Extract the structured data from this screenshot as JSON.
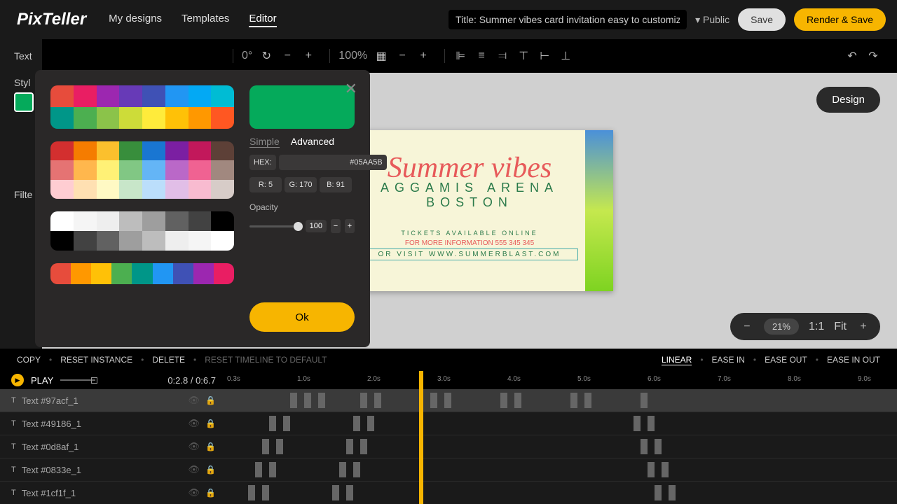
{
  "header": {
    "logo": "PixTeller",
    "nav": {
      "designs": "My designs",
      "templates": "Templates",
      "editor": "Editor"
    },
    "title_label": "Title:",
    "title_value": "Summer vibes card invitation easy to customiz",
    "visibility": "▾ Public",
    "save": "Save",
    "render": "Render & Save"
  },
  "sidebar": {
    "text": "Text",
    "style": "Styl",
    "filter": "Filte"
  },
  "toolbar": {
    "rotation": "0°",
    "zoom": "100%"
  },
  "canvas": {
    "design_chip": "Design",
    "card": {
      "title": "Summer vibes",
      "subtitle": "AGGAMIS ARENA BOSTON",
      "line1": "TICKETS AVAILABLE ONLINE",
      "line2": "FOR MORE INFORMATION 555 345 345",
      "line3": "OR VISIT WWW.SUMMERBLAST.COM"
    },
    "zoom": {
      "value": "21%",
      "ratio": "1:1",
      "fit": "Fit"
    }
  },
  "picker": {
    "tabs": {
      "simple": "Simple",
      "advanced": "Advanced"
    },
    "hex_label": "HEX:",
    "hex_value": "#05AA5B",
    "r_label": "R:",
    "r_val": "5",
    "g_label": "G:",
    "g_val": "170",
    "b_label": "B:",
    "b_val": "91",
    "opacity_label": "Opacity",
    "opacity_val": "100",
    "ok": "Ok",
    "preview_color": "#05AA5B"
  },
  "timeline": {
    "actions": {
      "copy": "COPY",
      "reset_instance": "RESET INSTANCE",
      "delete": "DELETE",
      "reset_tl": "RESET TIMELINE TO DEFAULT"
    },
    "easing": {
      "linear": "LINEAR",
      "ease_in": "EASE IN",
      "ease_out": "EASE OUT",
      "ease_in_out": "EASE IN OUT"
    },
    "play": "PLAY",
    "time": "0:2.8 / 0:6.7",
    "marks": [
      "0.3s",
      "1.0s",
      "2.0s",
      "3.0s",
      "4.0s",
      "5.0s",
      "6.0s",
      "7.0s",
      "8.0s",
      "9.0s"
    ],
    "tracks": [
      {
        "name": "Text #97acf_1"
      },
      {
        "name": "Text #49186_1"
      },
      {
        "name": "Text #0d8af_1"
      },
      {
        "name": "Text #0833e_1"
      },
      {
        "name": "Text #1cf1f_1"
      }
    ]
  },
  "palettes": {
    "p1": [
      "#e74c3c",
      "#e91e63",
      "#9c27b0",
      "#673ab7",
      "#3f51b5",
      "#2196f3",
      "#03a9f4",
      "#00bcd4",
      "#009688",
      "#4caf50",
      "#8bc34a",
      "#cddc39",
      "#ffeb3b",
      "#ffc107",
      "#ff9800",
      "#ff5722"
    ],
    "p2_top": [
      "#d32f2f",
      "#f57c00",
      "#fbc02d",
      "#388e3c",
      "#1976d2",
      "#7b1fa2",
      "#c2185b",
      "#5d4037"
    ],
    "p2_mid": [
      "#e57373",
      "#ffb74d",
      "#fff176",
      "#81c784",
      "#64b5f6",
      "#ba68c8",
      "#f06292",
      "#a1887f"
    ],
    "p2_bot": [
      "#ffcdd2",
      "#ffe0b2",
      "#fff9c4",
      "#c8e6c9",
      "#bbdefb",
      "#e1bee7",
      "#f8bbd0",
      "#d7ccc8"
    ],
    "gray": [
      "#ffffff",
      "#f5f5f5",
      "#eeeeee",
      "#bdbdbd",
      "#9e9e9e",
      "#616161",
      "#424242",
      "#000000"
    ],
    "accent": [
      "#e74c3c",
      "#ff9800",
      "#ffc107",
      "#4caf50",
      "#009688",
      "#2196f3",
      "#3f51b5",
      "#9c27b0",
      "#e91e63"
    ]
  }
}
